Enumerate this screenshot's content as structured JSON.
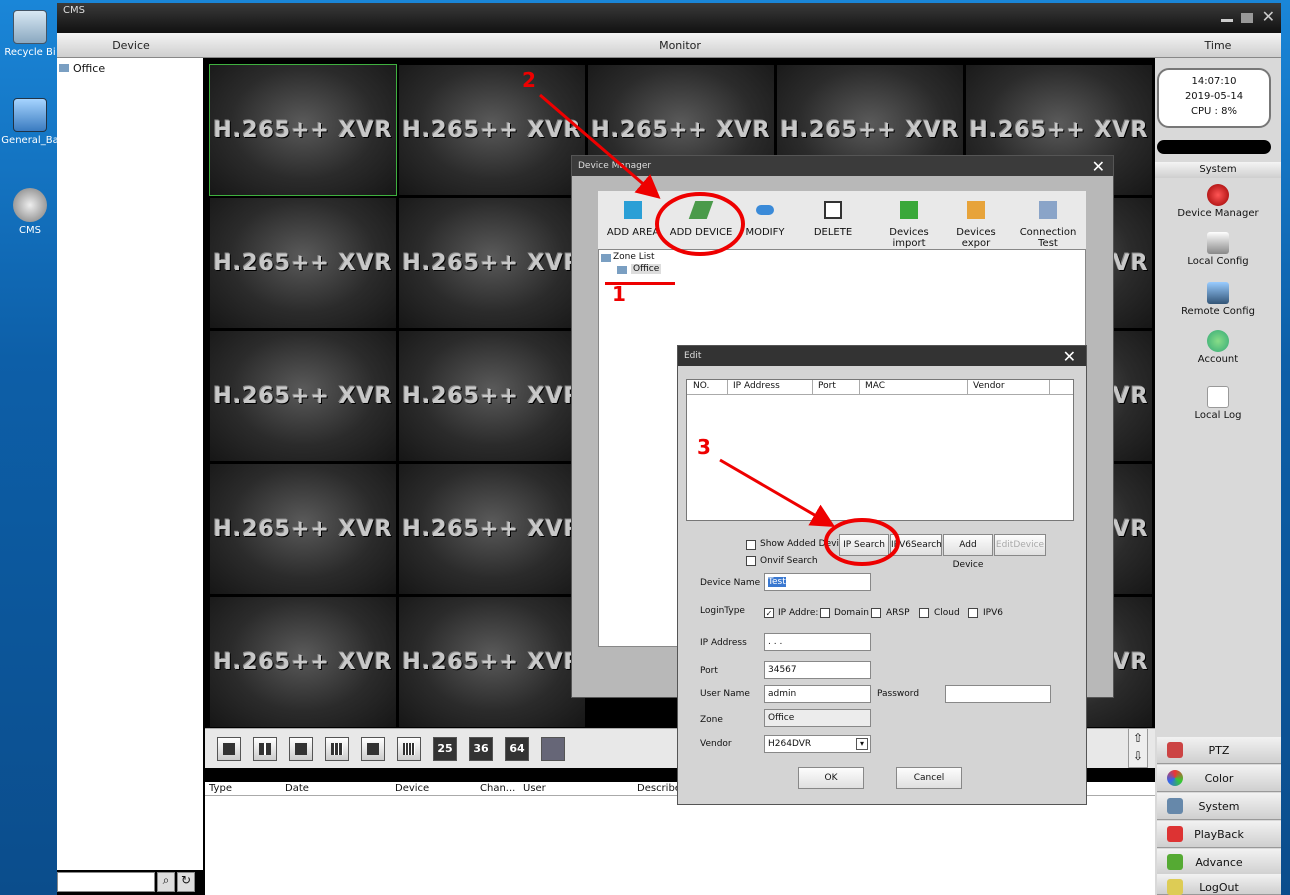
{
  "desktop": {
    "icons": [
      {
        "label": "Recycle Bi",
        "icon": "recycle-bin-icon"
      },
      {
        "label": "General_Ba",
        "icon": "computer-icon"
      },
      {
        "label": "CMS",
        "icon": "webcam-icon"
      }
    ]
  },
  "window": {
    "title": "CMS",
    "headers": {
      "device": "Device",
      "monitor": "Monitor",
      "time": "Time"
    }
  },
  "device_tree": {
    "root": "Office"
  },
  "video_tile_label": "H.265++ XVR",
  "time_panel": {
    "time": "14:07:10",
    "date": "2019-05-14",
    "cpu": "CPU : 8%"
  },
  "system_panel": {
    "title": "System",
    "items": [
      {
        "label": "Device Manager",
        "icon": "red-button-icon"
      },
      {
        "label": "Local Config",
        "icon": "computer-gear-icon"
      },
      {
        "label": "Remote Config",
        "icon": "remote-gear-icon"
      },
      {
        "label": "Account",
        "icon": "users-icon"
      },
      {
        "label": "Local Log",
        "icon": "document-icon"
      }
    ]
  },
  "bottom_menu": [
    {
      "label": "PTZ",
      "icon": "ptz-icon"
    },
    {
      "label": "Color",
      "icon": "color-icon"
    },
    {
      "label": "System",
      "icon": "system-icon"
    },
    {
      "label": "PlayBack",
      "icon": "clapper-icon"
    },
    {
      "label": "Advance",
      "icon": "advance-icon"
    },
    {
      "label": "LogOut",
      "icon": "logout-icon"
    }
  ],
  "layout_buttons": [
    "",
    "",
    "",
    "",
    "",
    "",
    "25",
    "36",
    "64"
  ],
  "log_table": {
    "columns": [
      "Type",
      "Date",
      "Device",
      "Chan...",
      "User",
      "Describe"
    ]
  },
  "device_manager": {
    "title": "Device Manager",
    "tools": [
      {
        "label": "ADD AREA",
        "icon": "add-area-icon"
      },
      {
        "label": "ADD DEVICE",
        "icon": "add-device-icon"
      },
      {
        "label": "MODIFY",
        "icon": "modify-icon"
      },
      {
        "label": "DELETE",
        "icon": "trash-icon"
      },
      {
        "label": "Devices import",
        "icon": "import-icon"
      },
      {
        "label": "Devices expor",
        "icon": "export-icon"
      },
      {
        "label": "Connection Test",
        "icon": "connection-icon"
      }
    ],
    "zone_list": "Zone List",
    "zone_office": "Office"
  },
  "edit_dialog": {
    "title": "Edit",
    "list_columns": [
      "NO.",
      "IP Address",
      "Port",
      "MAC",
      "Vendor"
    ],
    "show_added": "Show Added Devi",
    "onvif": "Onvif Search",
    "buttons": {
      "ip_search": "IP Search",
      "ipv6_search": "IPV6Search",
      "add_device": "Add Device",
      "edit_device": "EditDevice",
      "ok": "OK",
      "cancel": "Cancel"
    },
    "fields": {
      "device_name_label": "Device Name",
      "device_name": "Test",
      "login_type_label": "LoginType",
      "login_types": [
        "IP Addre:",
        "Domain",
        "ARSP",
        "Cloud",
        "IPV6"
      ],
      "ip_label": "IP Address",
      "ip_value": ".       .       .",
      "port_label": "Port",
      "port": "34567",
      "user_label": "User Name",
      "user": "admin",
      "password_label": "Password",
      "password": "",
      "zone_label": "Zone",
      "zone": "Office",
      "vendor_label": "Vendor",
      "vendor": "H264DVR"
    }
  },
  "annotations": {
    "step1": "1",
    "step2": "2",
    "step3": "3",
    "color": "#e00000"
  }
}
